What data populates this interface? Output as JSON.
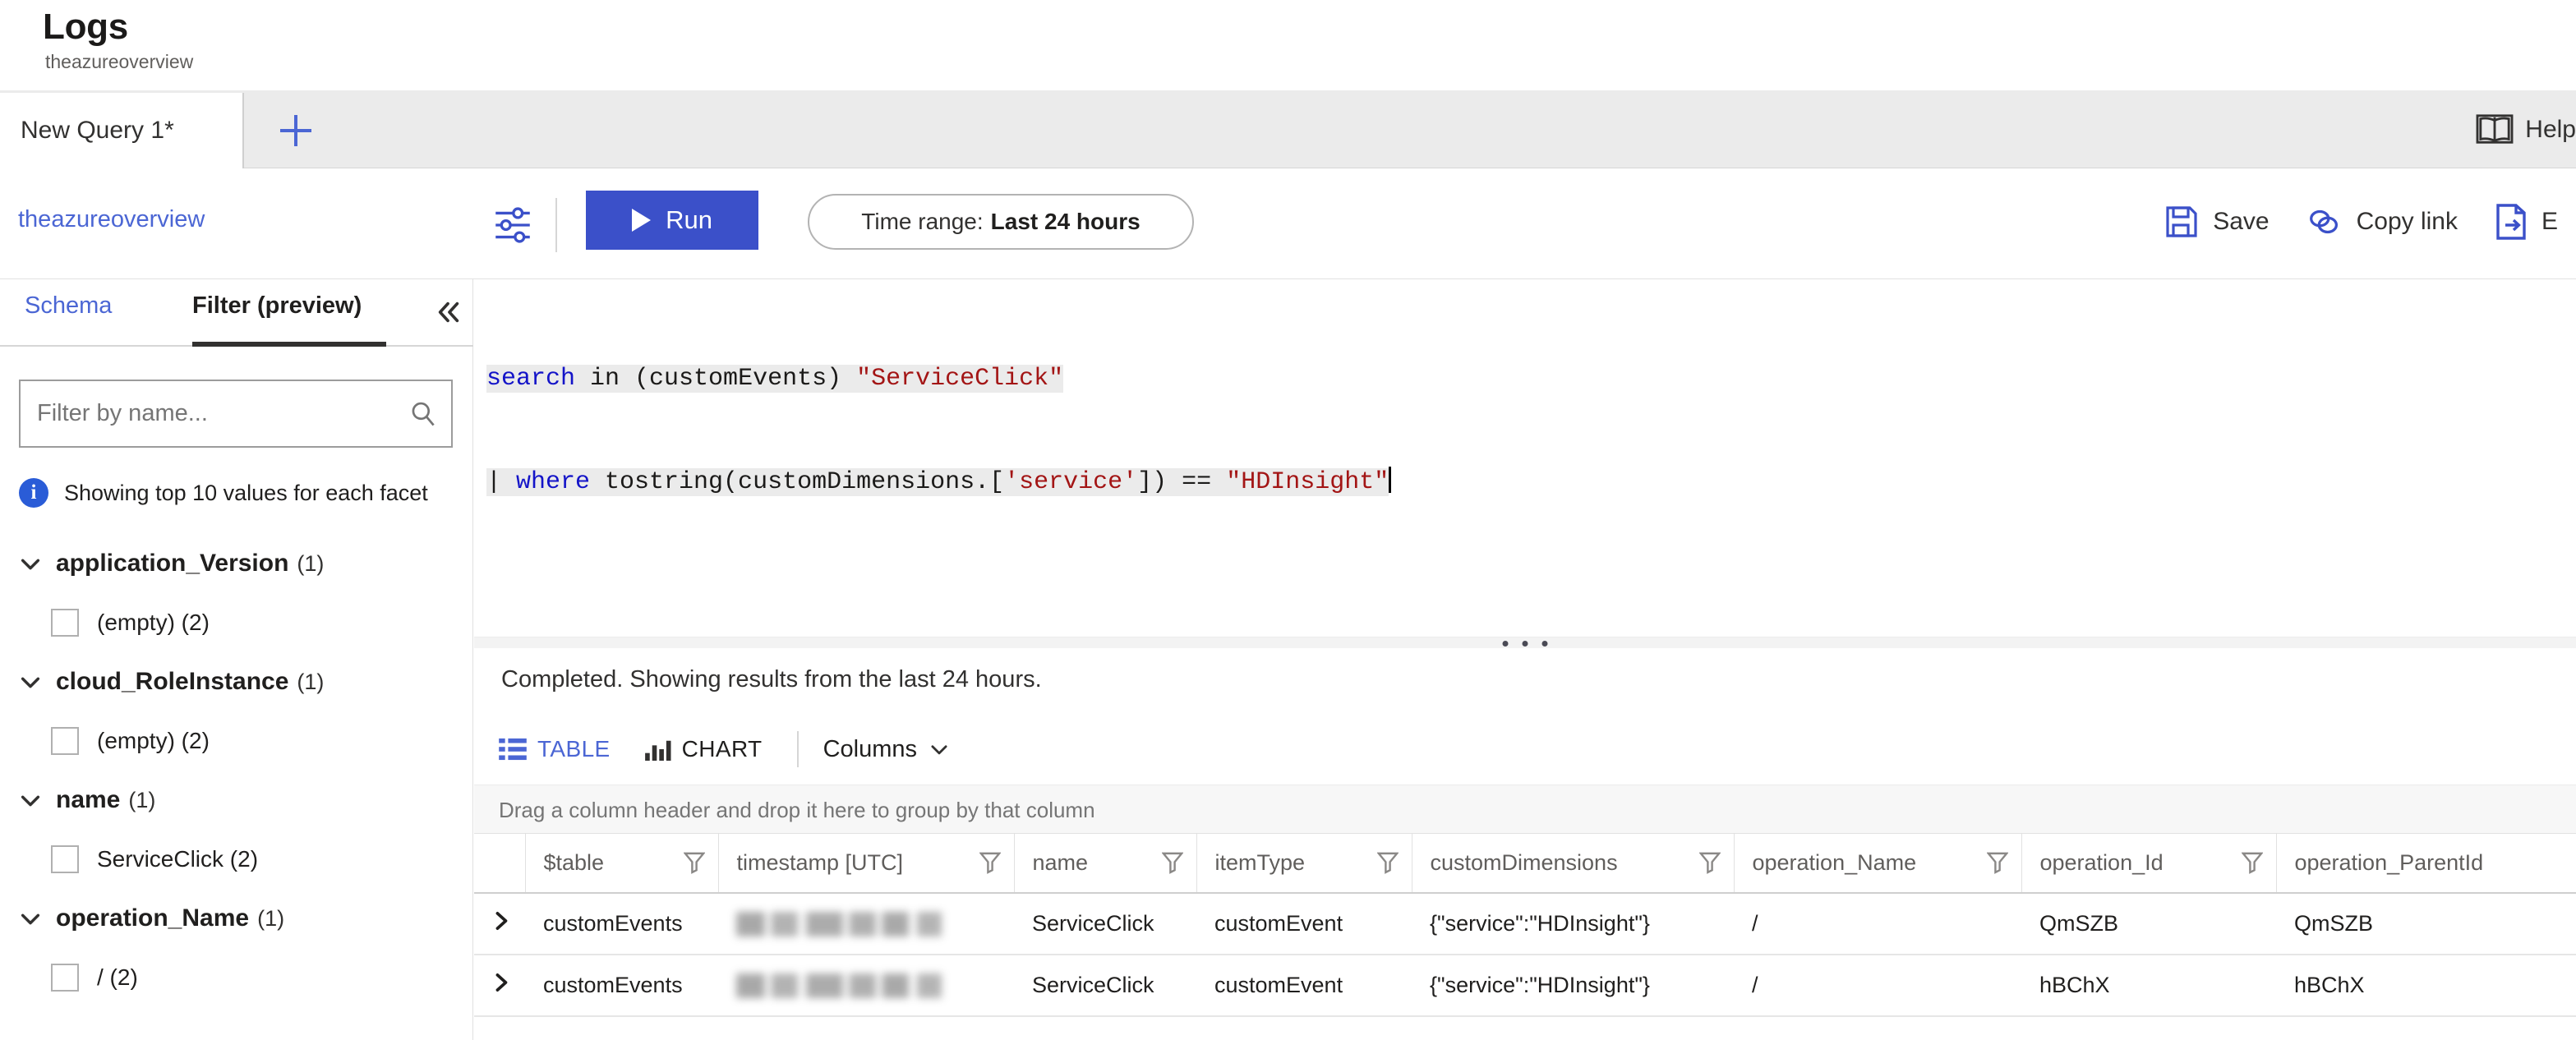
{
  "header": {
    "title": "Logs",
    "subtitle": "theazureoverview"
  },
  "tabs": {
    "items": [
      {
        "label": "New Query 1*"
      }
    ],
    "add_icon": "plus-icon",
    "help_label": "Help",
    "help_icon": "book-icon"
  },
  "commandbar": {
    "workspace_link": "theazureoverview",
    "settings_icon": "sliders-icon",
    "run_label": "Run",
    "run_icon": "play-icon",
    "run_color": "#3b50c9",
    "timerange_prefix": "Time range:",
    "timerange_value": "Last 24 hours",
    "actions": [
      {
        "label": "Save",
        "icon": "save-icon"
      },
      {
        "label": "Copy link",
        "icon": "link-icon"
      },
      {
        "label": "E",
        "icon": "export-icon"
      }
    ],
    "accent_color": "#4b66d4"
  },
  "left_panel": {
    "tabs": [
      {
        "label": "Schema",
        "selected": false
      },
      {
        "label": "Filter (preview)",
        "selected": true
      }
    ],
    "collapse_icon": "chevron-double-left-icon",
    "filter_placeholder": "Filter by name...",
    "filter_value": "",
    "search_icon": "search-icon",
    "info_text": "Showing top 10 values for each facet",
    "info_icon": "info-icon",
    "facets": [
      {
        "name": "application_Version",
        "count": "(1)",
        "values": [
          {
            "label": "(empty) (2)",
            "checked": false
          }
        ]
      },
      {
        "name": "cloud_RoleInstance",
        "count": "(1)",
        "values": [
          {
            "label": "(empty) (2)",
            "checked": false
          }
        ]
      },
      {
        "name": "name",
        "count": "(1)",
        "values": [
          {
            "label": "ServiceClick (2)",
            "checked": false
          }
        ]
      },
      {
        "name": "operation_Name",
        "count": "(1)",
        "values": [
          {
            "label": "/ (2)",
            "checked": false
          }
        ]
      }
    ]
  },
  "editor": {
    "line1": {
      "kw": "search",
      "mid": " in (customEvents) ",
      "str": "\"ServiceClick\""
    },
    "line2": {
      "pipe": "| ",
      "kw": "where",
      "mid": " tostring(customDimensions.[",
      "str1": "'service'",
      "mid2": "]) == ",
      "str2": "\"HDInsight\""
    },
    "full_text": "search in (customEvents) \"ServiceClick\"\n| where tostring(customDimensions.['service']) == \"HDInsight\""
  },
  "results": {
    "status": "Completed. Showing results from the last 24 hours.",
    "view_tabs": [
      {
        "label": "TABLE",
        "icon": "table-icon",
        "selected": true
      },
      {
        "label": "CHART",
        "icon": "bar-chart-icon",
        "selected": false
      }
    ],
    "columns_label": "Columns",
    "columns_chevron": "chevron-down-icon",
    "group_hint": "Drag a column header and drop it here to group by that column",
    "table": {
      "columns": [
        "",
        "$table",
        "timestamp [UTC]",
        "name",
        "itemType",
        "customDimensions",
        "operation_Name",
        "operation_Id",
        "operation_ParentId"
      ],
      "rows": [
        {
          "expand_icon": "chevron-right-icon",
          "table": "customEvents",
          "timestamp": "",
          "timestamp_redacted": true,
          "name": "ServiceClick",
          "itemType": "customEvent",
          "customDimensions": "{\"service\":\"HDInsight\"}",
          "operation_Name": "/",
          "operation_Id": "QmSZB",
          "operation_ParentId": "QmSZB"
        },
        {
          "expand_icon": "chevron-right-icon",
          "table": "customEvents",
          "timestamp": "",
          "timestamp_redacted": true,
          "name": "ServiceClick",
          "itemType": "customEvent",
          "customDimensions": "{\"service\":\"HDInsight\"}",
          "operation_Name": "/",
          "operation_Id": "hBChX",
          "operation_ParentId": "hBChX"
        }
      ]
    }
  }
}
